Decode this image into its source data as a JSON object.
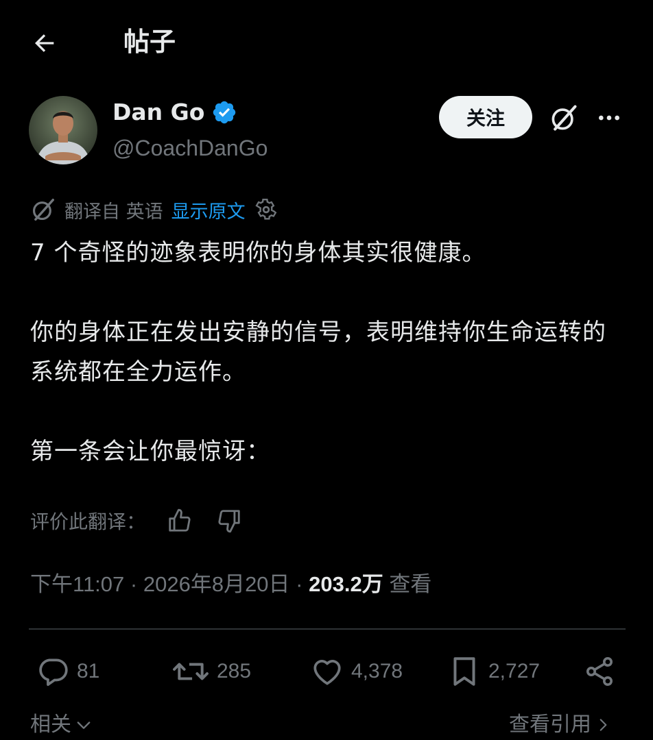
{
  "header": {
    "title": "帖子"
  },
  "author": {
    "name": "Dan Go",
    "handle": "@CoachDanGo",
    "verified": true
  },
  "actions": {
    "follow_label": "关注"
  },
  "translation": {
    "label": "翻译自 英语",
    "show_original": "显示原文"
  },
  "post": {
    "paragraphs": [
      "7 个奇怪的迹象表明你的身体其实很健康。",
      "你的身体正在发出安静的信号，表明维持你生命运转的系统都在全力运作。",
      "第一条会让你最惊讶："
    ]
  },
  "rate_translation": {
    "label": "评价此翻译："
  },
  "meta": {
    "time": "下午11:07",
    "date": "2026年8月20日",
    "views_count": "203.2万",
    "views_label": "查看",
    "separator": "·"
  },
  "stats": {
    "replies": "81",
    "reposts": "285",
    "likes": "4,378",
    "bookmarks": "2,727"
  },
  "footer": {
    "related": "相关",
    "view_quotes": "查看引用"
  },
  "colors": {
    "background": "#000000",
    "text": "#e7e9ea",
    "muted": "#71767b",
    "accent": "#1d9bf0",
    "follow_bg": "#eff3f4"
  }
}
